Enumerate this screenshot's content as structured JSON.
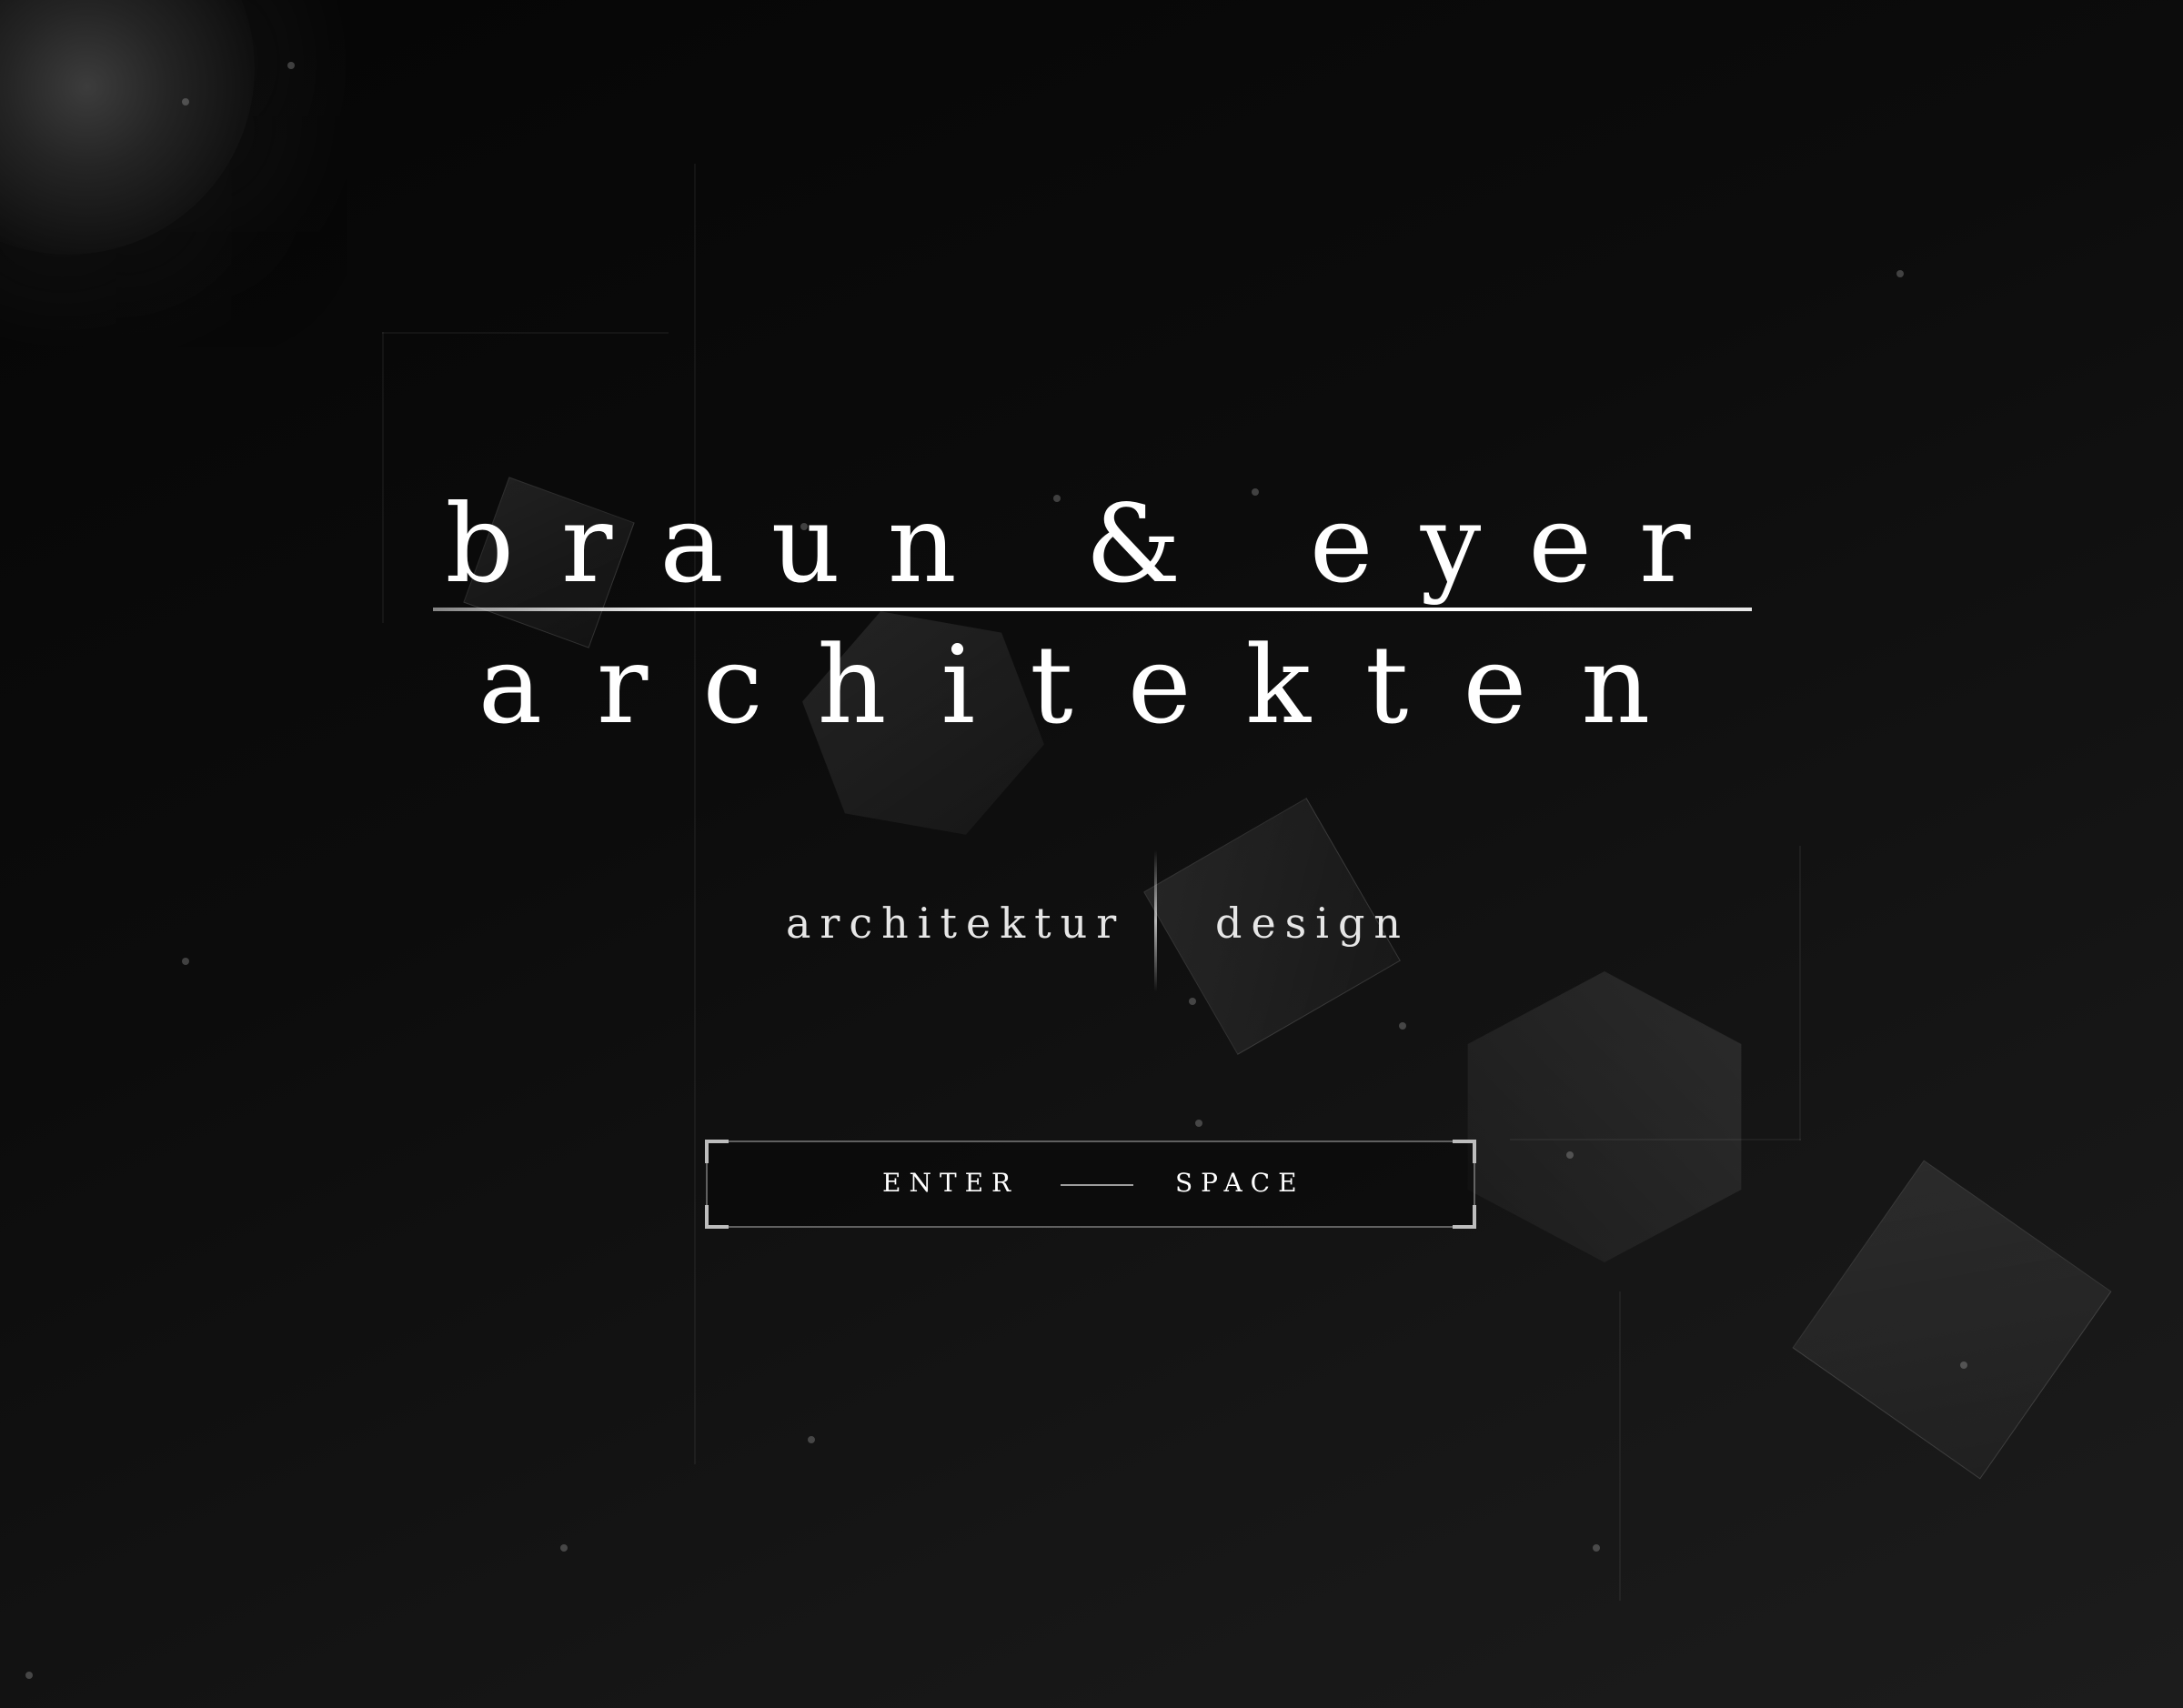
{
  "brand": {
    "line1": "braun & eyer",
    "line2": "architekten"
  },
  "tagline": {
    "left": "architektur",
    "right": "design"
  },
  "enter_button": {
    "left_label": "ENTER",
    "right_label": "SPACE"
  },
  "colors": {
    "background": "#0b0b0b",
    "text": "#ffffff",
    "accent": "#bdbdbd"
  }
}
